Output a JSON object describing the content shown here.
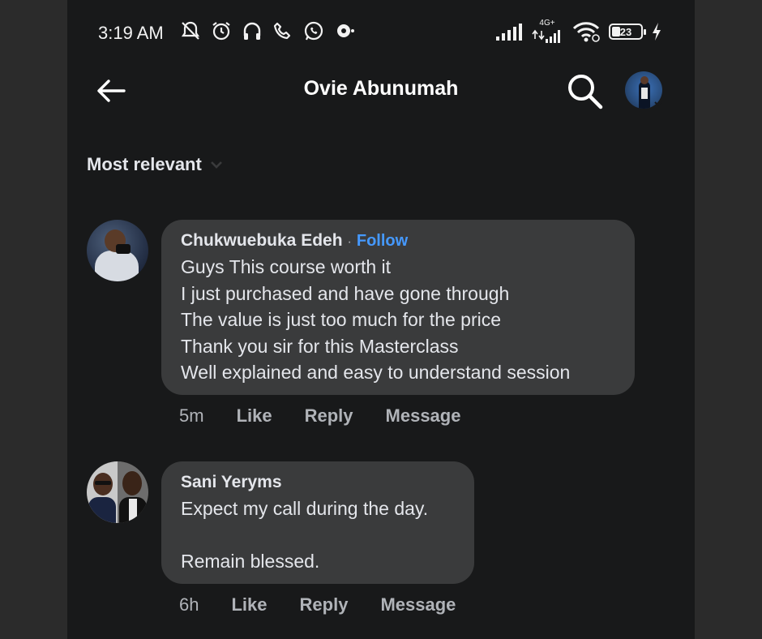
{
  "status_bar": {
    "time": "3:19 AM",
    "network_label": "4G+",
    "battery": "23",
    "icons": [
      "notifications-off-icon",
      "alarm-icon",
      "headphones-icon",
      "call-icon",
      "whatsapp-icon",
      "media-icon",
      "signal-icon",
      "signal-icon",
      "wifi-icon",
      "battery-icon",
      "charging-icon"
    ]
  },
  "header": {
    "title": "Ovie Abunumah",
    "back_icon": "back-arrow-icon",
    "search_icon": "search-icon"
  },
  "sort": {
    "label": "Most relevant",
    "icon": "chevron-down-icon"
  },
  "comments": [
    {
      "author": "Chukwuebuka Edeh",
      "separator": "·",
      "follow": "Follow",
      "text": "Guys This course worth it\nI just purchased and have gone through\nThe value is just too much for the price\nThank you sir for this Masterclass\nWell explained and easy to understand session",
      "time": "5m",
      "like": "Like",
      "reply": "Reply",
      "message": "Message"
    },
    {
      "author": "Sani Yeryms",
      "text": "Expect my call during the day.\n\nRemain blessed.",
      "time": "6h",
      "like": "Like",
      "reply": "Reply",
      "message": "Message"
    }
  ],
  "colors": {
    "background": "#18191a",
    "bubble": "#3a3b3c",
    "text": "#e4e6eb",
    "secondary_text": "#b0b3b8",
    "follow_link": "#4599ff"
  }
}
